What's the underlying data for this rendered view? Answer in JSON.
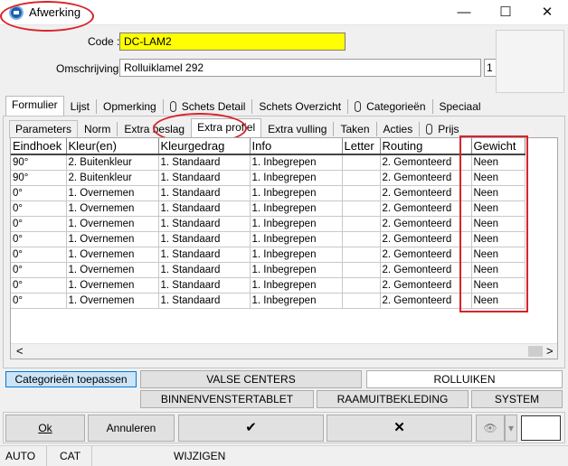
{
  "window": {
    "title": "Afwerking",
    "min_glyph": "—",
    "max_glyph": "☐",
    "close_glyph": "✕"
  },
  "form": {
    "code_label": "Code :",
    "code_value": "DC-LAM2",
    "code_bg": "#ffff00",
    "omschrijving_label": "Omschrijving :",
    "omschrijving_value": "Rolluiklamel 292",
    "side_value": "1"
  },
  "main_tabs": [
    "Formulier",
    "Lijst",
    "Opmerking",
    "Schets Detail",
    "Schets Overzicht",
    "Categorieën",
    "Speciaal"
  ],
  "sub_tabs": [
    "Parameters",
    "Norm",
    "Extra beslag",
    "Extra profiel",
    "Extra vulling",
    "Taken",
    "Acties",
    "Prijs"
  ],
  "grid": {
    "columns": [
      "Eindhoek",
      "Kleur(en)",
      "Kleurgedrag",
      "Info",
      "Letter",
      "Routing",
      "Gewicht"
    ],
    "rows": [
      [
        "90°",
        "2. Buitenkleur",
        "1. Standaard",
        "1. Inbegrepen",
        "",
        "2. Gemonteerd",
        "Neen"
      ],
      [
        "90°",
        "2. Buitenkleur",
        "1. Standaard",
        "1. Inbegrepen",
        "",
        "2. Gemonteerd",
        "Neen"
      ],
      [
        "0°",
        "1. Overnemen",
        "1. Standaard",
        "1. Inbegrepen",
        "",
        "2. Gemonteerd",
        "Neen"
      ],
      [
        "0°",
        "1. Overnemen",
        "1. Standaard",
        "1. Inbegrepen",
        "",
        "2. Gemonteerd",
        "Neen"
      ],
      [
        "0°",
        "1. Overnemen",
        "1. Standaard",
        "1. Inbegrepen",
        "",
        "2. Gemonteerd",
        "Neen"
      ],
      [
        "0°",
        "1. Overnemen",
        "1. Standaard",
        "1. Inbegrepen",
        "",
        "2. Gemonteerd",
        "Neen"
      ],
      [
        "0°",
        "1. Overnemen",
        "1. Standaard",
        "1. Inbegrepen",
        "",
        "2. Gemonteerd",
        "Neen"
      ],
      [
        "0°",
        "1. Overnemen",
        "1. Standaard",
        "1. Inbegrepen",
        "",
        "2. Gemonteerd",
        "Neen"
      ],
      [
        "0°",
        "1. Overnemen",
        "1. Standaard",
        "1. Inbegrepen",
        "",
        "2. Gemonteerd",
        "Neen"
      ],
      [
        "0°",
        "1. Overnemen",
        "1. Standaard",
        "1. Inbegrepen",
        "",
        "2. Gemonteerd",
        "Neen"
      ]
    ],
    "scroll_left": "<",
    "scroll_right": ">"
  },
  "buttons": {
    "categorieen_toepassen": "Categorieën toepassen",
    "valse_centers": "VALSE CENTERS",
    "rolluiken": "ROLLUIKEN",
    "binnenvenstertablet": "BINNENVENSTERTABLET",
    "raamuitbekleding": "RAAMUITBEKLEDING",
    "system": "SYSTEM",
    "ok": "Ok",
    "annuleren": "Annuleren",
    "check_glyph": "✔",
    "cross_glyph": "✕",
    "binoculars_glyph": "👁",
    "dropdown_glyph": "▾"
  },
  "status": {
    "cell1": "AUTO",
    "cell2": "CAT",
    "cell3": "WIJZIGEN"
  },
  "colors": {
    "annotation_red": "#d9232a",
    "active_blue": "#cce4f7"
  }
}
